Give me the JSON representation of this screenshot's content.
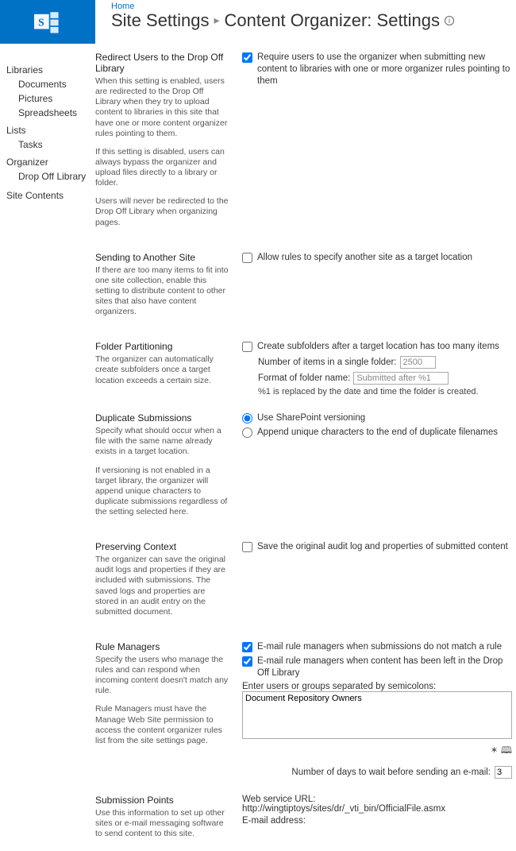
{
  "header": {
    "home_link": "Home",
    "title_left": "Site Settings",
    "title_right": "Content Organizer: Settings"
  },
  "nav": {
    "libraries_heading": "Libraries",
    "libraries": {
      "documents": "Documents",
      "pictures": "Pictures",
      "spreadsheets": "Spreadsheets"
    },
    "lists_heading": "Lists",
    "lists": {
      "tasks": "Tasks"
    },
    "organizer_heading": "Organizer",
    "organizer": {
      "dropoff": "Drop Off Library"
    },
    "site_contents": "Site Contents"
  },
  "redirect": {
    "title": "Redirect Users to the Drop Off Library",
    "p1": "When this setting is enabled, users are redirected to the Drop Off Library when they try to upload content to libraries in this site that have one or more content organizer rules pointing to them.",
    "p2": "If this setting is disabled, users can always bypass the organizer and upload files directly to a library or folder.",
    "p3": "Users will never be redirected to the Drop Off Library when organizing pages.",
    "checkbox_label": "Require users to use the organizer when submitting new content to libraries with one or more organizer rules pointing to them"
  },
  "sending": {
    "title": "Sending to Another Site",
    "p1": "If there are too many items to fit into one site collection, enable this setting to distribute content to other sites that also have content organizers.",
    "checkbox_label": "Allow rules to specify another site as a target location"
  },
  "folder": {
    "title": "Folder Partitioning",
    "p1": "The organizer can automatically create subfolders once a target location exceeds a certain size.",
    "checkbox_label": "Create subfolders after a target location has too many items",
    "num_label": "Number of items in a single folder:",
    "num_value": "2500",
    "format_label": "Format of folder name:",
    "format_value": "Submitted after %1",
    "note": "%1 is replaced by the date and time the folder is created."
  },
  "duplicate": {
    "title": "Duplicate Submissions",
    "p1": "Specify what should occur when a file with the same name already exists in a target location.",
    "p2": "If versioning is not enabled in a target library, the organizer will append unique characters to duplicate submissions regardless of the setting selected here.",
    "r1": "Use SharePoint versioning",
    "r2": "Append unique characters to the end of duplicate filenames"
  },
  "preserve": {
    "title": "Preserving Context",
    "p1": "The organizer can save the original audit logs and properties if they are included with submissions. The saved logs and properties are stored in an audit entry on the submitted document.",
    "checkbox_label": "Save the original audit log and properties of submitted content"
  },
  "managers": {
    "title": "Rule Managers",
    "p1": "Specify the users who manage the rules and can respond when incoming content doesn't match any rule.",
    "p2": "Rule Managers must have the Manage Web Site permission to access the content organizer rules list from the site settings page.",
    "cb1": "E-mail rule managers when submissions do not match a rule",
    "cb2": "E-mail rule managers when content has been left in the Drop Off Library",
    "enter_label": "Enter users or groups separated by semicolons:",
    "textarea_value": "Document Repository Owners",
    "days_label": "Number of days to wait before sending an e-mail:",
    "days_value": "3"
  },
  "submission": {
    "title": "Submission Points",
    "p1": "Use this information to set up other sites or e-mail messaging software to send content to this site.",
    "ws_label": "Web service URL: http://wingtiptoys/sites/dr/_vti_bin/OfficialFile.asmx",
    "email_label": "E-mail address:"
  }
}
